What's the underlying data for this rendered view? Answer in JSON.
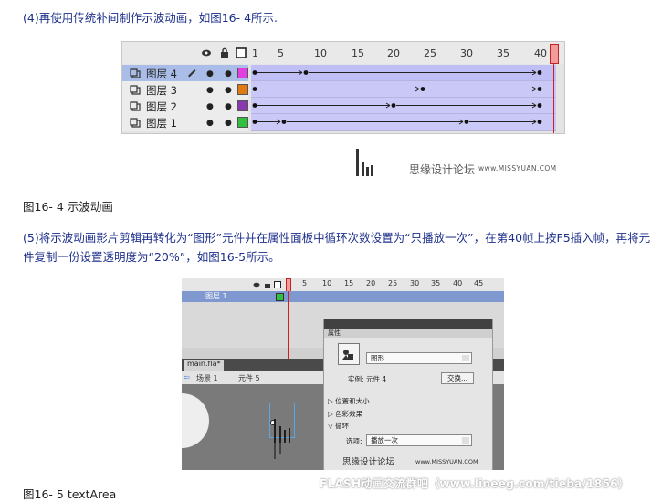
{
  "paragraph1": "(4)再使用传统补间制作示波动画，如图16- 4所示.",
  "caption1": "图16- 4 示波动画",
  "paragraph2": "(5)将示波动画影片剪辑再转化为“图形”元件并在属性面板中循环次数设置为“只播放一次”，在第40帧上按F5插入帧，再将元件复制一份设置透明度为“20%”，如图16-5所示。",
  "caption2": "图16- 5 textArea",
  "figure1": {
    "header_icons": [
      "eye-icon",
      "lock-icon",
      "outline-square-icon"
    ],
    "frame_numbers": [
      "1",
      "5",
      "10",
      "15",
      "20",
      "25",
      "30",
      "35",
      "40"
    ],
    "layers": [
      {
        "name": "图层 4",
        "color": "#e040e0",
        "selected": true,
        "keyframes": [
          1,
          8,
          40
        ]
      },
      {
        "name": "图层 3",
        "color": "#e07a10",
        "selected": false,
        "keyframes": [
          1,
          24,
          40
        ]
      },
      {
        "name": "图层 2",
        "color": "#8a38b0",
        "selected": false,
        "keyframes": [
          1,
          20,
          40
        ]
      },
      {
        "name": "图层 1",
        "color": "#30c040",
        "selected": false,
        "keyframes": [
          1,
          5,
          30,
          40
        ]
      }
    ],
    "current_frame": 40
  },
  "watermark1": {
    "cn": "思缘设计论坛",
    "url": "www.MISSYUAN.COM"
  },
  "figure2": {
    "frame_numbers": [
      "1",
      "5",
      "10",
      "15",
      "20",
      "25",
      "30",
      "35",
      "40",
      "45"
    ],
    "layer_name": "图层 1",
    "doc_tab": "main.fla*",
    "breadcrumb": [
      "场景 1",
      "元件 5"
    ],
    "panel": {
      "tab": "属性",
      "type_select": "图形",
      "instance_label": "实例:",
      "instance_value": "元件 4",
      "swap_button": "交换...",
      "sections": [
        "位置和大小",
        "色彩效果",
        "循环"
      ],
      "option_label": "选项:",
      "option_value": "播放一次"
    }
  },
  "watermark2": {
    "cn": "思缘设计论坛",
    "url": "www.MISSYUAN.COM"
  },
  "watermark3": "FLASH动画交流群吧（www.lineeg.com/tieba/1856）"
}
